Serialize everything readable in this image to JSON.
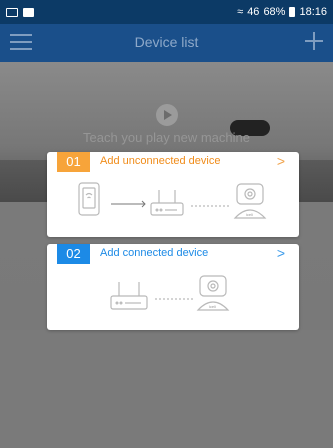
{
  "status_bar": {
    "signal": "46",
    "net": "46",
    "battery": "68%",
    "time": "18:16"
  },
  "app_bar": {
    "title": "Device list"
  },
  "banner": {
    "text": "Teach you play new machine"
  },
  "cards": [
    {
      "number": "01",
      "title": "Add unconnected device",
      "chevron": ">"
    },
    {
      "number": "02",
      "title": "Add connected device",
      "chevron": ">"
    }
  ],
  "colors": {
    "app_bar": "#1a4f8a",
    "status_bar": "#0c3a66",
    "orange_accent": "#f7a43a",
    "blue_accent": "#1c8ae6"
  }
}
